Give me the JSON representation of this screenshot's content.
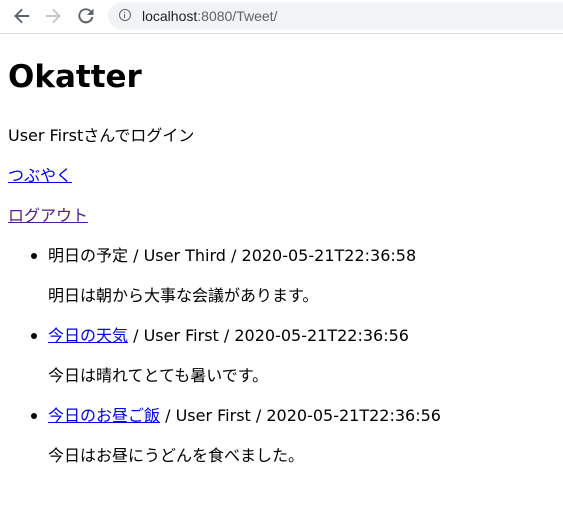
{
  "browser": {
    "url_host": "localhost",
    "url_rest": ":8080/Tweet/"
  },
  "page": {
    "title": "Okatter",
    "login_status": "User Firstさんでログイン",
    "tweet_link": "つぶやく",
    "logout_link": "ログアウト",
    "tweets": [
      {
        "title": "明日の予定",
        "suffix": " / User Third / 2020-05-21T22:36:58",
        "linked": false,
        "body": "明日は朝から大事な会議があります。"
      },
      {
        "title": "今日の天気",
        "suffix": " / User First / 2020-05-21T22:36:56",
        "linked": true,
        "body": "今日は晴れてとても暑いです。"
      },
      {
        "title": "今日のお昼ご飯",
        "suffix": " / User First / 2020-05-21T22:36:56",
        "linked": true,
        "body": "今日はお昼にうどんを食べました。"
      }
    ]
  }
}
